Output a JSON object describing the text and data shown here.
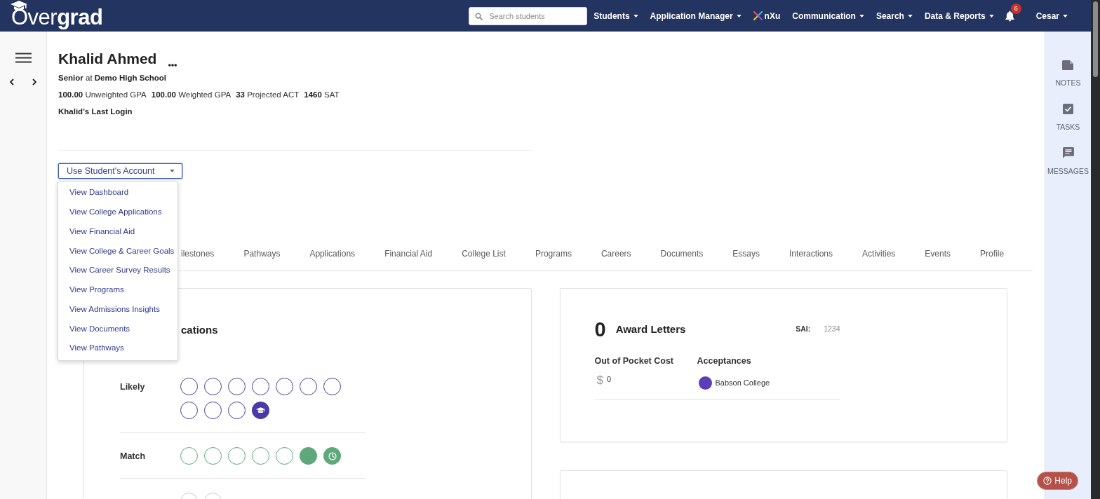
{
  "navbar": {
    "logo": "Over**grad**",
    "search": {
      "placeholder": "Search students"
    },
    "menus": [
      {
        "label": "Students",
        "kind": "dropdown"
      },
      {
        "label": "Application Manager",
        "kind": "dropdown"
      },
      {
        "label": "nXu",
        "kind": "brand"
      },
      {
        "label": "Communication",
        "kind": "dropdown"
      },
      {
        "label": "Search",
        "kind": "dropdown"
      },
      {
        "label": "Data & Reports",
        "kind": "dropdown"
      }
    ],
    "notifications": "6",
    "user": "Cesar"
  },
  "student": {
    "name": "Khalid Ahmed",
    "subtitle": "**Senior** at **Demo High School**",
    "stats": [
      "**100.00** Unweighted GPA",
      "**100.00** Weighted GPA",
      "**33** Projected ACT",
      "**1460** SAT"
    ],
    "last_login": "Khalid's Last Login"
  },
  "account_menu": {
    "label": "Use Student's Account",
    "expanded": true,
    "items": [
      "View Dashboard",
      "View College Applications",
      "View Financial Aid",
      "View College & Career Goals",
      "View Career Survey Results",
      "View Programs",
      "View Admissions Insights",
      "View Documents",
      "View Pathways"
    ]
  },
  "tabs": [
    {
      "label": "ilestones",
      "selected": false
    },
    {
      "label": "Pathways",
      "selected": false
    },
    {
      "label": "Applications",
      "selected": false
    },
    {
      "label": "Financial Aid",
      "selected": false
    },
    {
      "label": "College List",
      "selected": false
    },
    {
      "label": "Programs",
      "selected": false
    },
    {
      "label": "Careers",
      "selected": false
    },
    {
      "label": "Documents",
      "selected": false
    },
    {
      "label": "Essays",
      "selected": false
    },
    {
      "label": "Interactions",
      "selected": false
    },
    {
      "label": "Activities",
      "selected": false
    },
    {
      "label": "Events",
      "selected": false
    },
    {
      "label": "Profile",
      "selected": false
    }
  ],
  "applications_card": {
    "title": "cations",
    "groups": [
      {
        "label": "Likely",
        "color": "#4b3aa6",
        "circles": [
          {
            "kind": "empty"
          },
          {
            "kind": "empty"
          },
          {
            "kind": "empty"
          },
          {
            "kind": "empty"
          },
          {
            "kind": "empty"
          },
          {
            "kind": "empty"
          },
          {
            "kind": "empty"
          },
          {
            "kind": "empty"
          },
          {
            "kind": "empty"
          },
          {
            "kind": "empty"
          },
          {
            "kind": "accepted"
          }
        ]
      },
      {
        "label": "Match",
        "color": "#5ea87c",
        "circles": [
          {
            "kind": "empty"
          },
          {
            "kind": "empty"
          },
          {
            "kind": "empty"
          },
          {
            "kind": "empty"
          },
          {
            "kind": "empty"
          },
          {
            "kind": "filled"
          },
          {
            "kind": "waiting"
          }
        ]
      },
      {
        "color": "#c9c9c9",
        "circles": [
          {
            "kind": "empty"
          },
          {
            "kind": "empty"
          }
        ]
      }
    ]
  },
  "award_card": {
    "count": "0",
    "title": "Award Letters",
    "sai_label": "SAI:",
    "sai_value": "1234",
    "cost_label": "Out of Pocket Cost",
    "cost_currency": "$",
    "cost_value": "0",
    "acceptances_label": "Acceptances",
    "acceptances": [
      {
        "name": "Babson College",
        "color": "#5a3fb8"
      }
    ]
  },
  "right_sidebar": [
    {
      "label": "NOTES",
      "kind": "notes"
    },
    {
      "label": "TASKS",
      "kind": "tasks"
    },
    {
      "label": "MESSAGES",
      "kind": "messages"
    }
  ],
  "help": "Help"
}
